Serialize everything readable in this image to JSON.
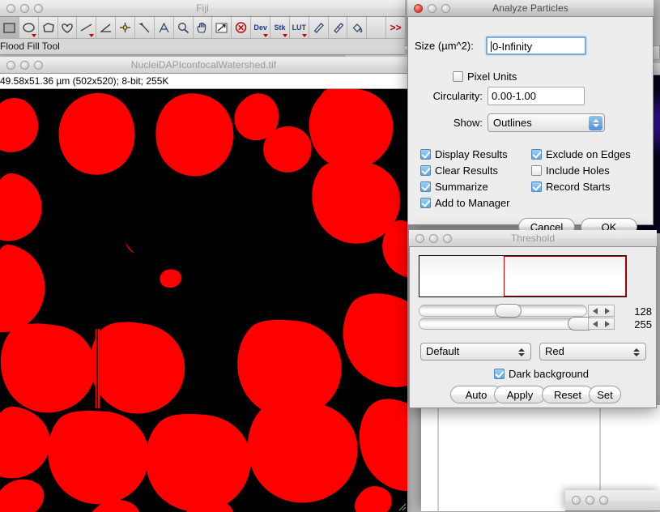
{
  "fiji": {
    "title": "Fiji",
    "status_text": "Flood Fill Tool",
    "tools": [
      {
        "name": "rectangle-tool",
        "label": "rectangle"
      },
      {
        "name": "oval-tool",
        "label": "oval"
      },
      {
        "name": "polygon-tool",
        "label": "polygon"
      },
      {
        "name": "freehand-tool",
        "label": "freehand"
      },
      {
        "name": "line-tool",
        "label": "line"
      },
      {
        "name": "angle-tool",
        "label": "angle"
      },
      {
        "name": "point-tool",
        "label": "point"
      },
      {
        "name": "wand-tool",
        "label": "wand"
      },
      {
        "name": "text-tool",
        "label": "text"
      },
      {
        "name": "magnifier-tool",
        "label": "magnifier"
      },
      {
        "name": "hand-tool",
        "label": "hand"
      },
      {
        "name": "dropper-tool",
        "label": "dropper"
      },
      {
        "name": "stop-tool",
        "label": "stop"
      },
      {
        "name": "dev-tool",
        "label": "Dev"
      },
      {
        "name": "stk-tool",
        "label": "Stk"
      },
      {
        "name": "lut-tool",
        "label": "LUT"
      },
      {
        "name": "pencil-tool",
        "label": "pencil"
      },
      {
        "name": "brush-tool",
        "label": "brush"
      },
      {
        "name": "flood-fill-tool",
        "label": "flood fill"
      },
      {
        "name": "blank-tool",
        "label": ""
      },
      {
        "name": "more-tools",
        "label": ">>"
      }
    ]
  },
  "image_window": {
    "title": "NucleiDAPIconfocalWatershed.tif",
    "info": "49.58x51.36 µm (502x520); 8-bit; 255K"
  },
  "analyze_particles": {
    "title": "Analyze Particles",
    "size_label": "Size (µm^2):",
    "size_value": "0-Infinity",
    "pixel_units_label": "Pixel Units",
    "pixel_units_checked": false,
    "circularity_label": "Circularity:",
    "circularity_value": "0.00-1.00",
    "show_label": "Show:",
    "show_value": "Outlines",
    "checks_left": [
      {
        "label": "Display Results",
        "checked": true
      },
      {
        "label": "Clear Results",
        "checked": true
      },
      {
        "label": "Summarize",
        "checked": true
      },
      {
        "label": "Add to Manager",
        "checked": true
      }
    ],
    "checks_right": [
      {
        "label": "Exclude on Edges",
        "checked": true
      },
      {
        "label": "Include Holes",
        "checked": false
      },
      {
        "label": "Record Starts",
        "checked": true
      }
    ],
    "cancel_label": "Cancel",
    "ok_label": "OK"
  },
  "threshold": {
    "title": "Threshold",
    "min_value": "128",
    "max_value": "255",
    "method": "Default",
    "lut": "Red",
    "dark_background_label": "Dark background",
    "dark_background_checked": true,
    "buttons": [
      "Auto",
      "Apply",
      "Reset",
      "Set"
    ],
    "accent_red": "#d00000"
  },
  "colors": {
    "nuclei_fill": "#ff0000",
    "image_background": "#000000",
    "desktop": "#b9b9b9"
  }
}
